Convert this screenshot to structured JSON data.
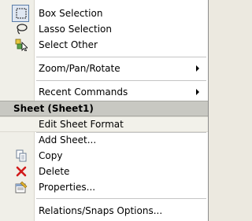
{
  "menu": {
    "items": [
      {
        "label": "Box Selection",
        "icon": "box-selection-icon"
      },
      {
        "label": "Lasso Selection",
        "icon": "lasso-icon"
      },
      {
        "label": "Select Other",
        "icon": "select-other-icon"
      },
      {
        "label": "Zoom/Pan/Rotate",
        "submenu": true
      },
      {
        "label": "Recent Commands",
        "submenu": true
      }
    ],
    "section_header": "Sheet (Sheet1)",
    "sheet_items": [
      {
        "label": "Edit Sheet Format"
      },
      {
        "label": "Add Sheet..."
      },
      {
        "label": "Copy",
        "icon": "copy-icon"
      },
      {
        "label": "Delete",
        "icon": "delete-icon"
      },
      {
        "label": "Properties...",
        "icon": "properties-icon"
      },
      {
        "label": "Relations/Snaps Options..."
      }
    ]
  },
  "colors": {
    "delete_red": "#d11a1a",
    "header_bg": "#c8c8c2",
    "gutter_bg": "#f0efe8"
  }
}
